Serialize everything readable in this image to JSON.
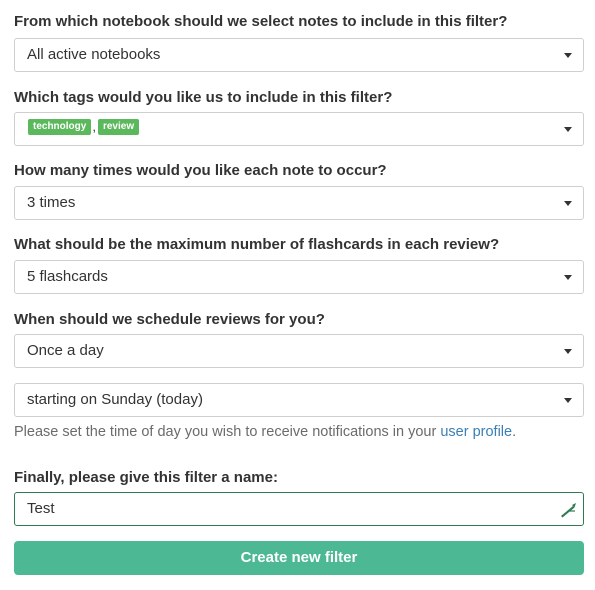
{
  "form": {
    "notebook": {
      "question": "From which notebook should we select notes to include in this filter?",
      "selected": "All active notebooks"
    },
    "tags": {
      "question": "Which tags would you like us to include in this filter?",
      "items": [
        "technology",
        "review"
      ],
      "separator": ","
    },
    "occurrences": {
      "question": "How many times would you like each note to occur?",
      "selected": "3 times"
    },
    "max_flashcards": {
      "question": "What should be the maximum number of flashcards in each review?",
      "selected": "5 flashcards"
    },
    "schedule": {
      "question": "When should we schedule reviews for you?",
      "frequency": "Once a day",
      "start": "starting on Sunday (today)",
      "hint_prefix": "Please set the time of day you wish to receive notifications in your ",
      "hint_link": "user profile",
      "hint_suffix": "."
    },
    "name": {
      "question": "Finally, please give this filter a name:",
      "value": "Test"
    },
    "submit_label": "Create new filter"
  },
  "icons": {
    "dropdown": "caret-down-icon",
    "name_field": "pen-icon"
  },
  "colors": {
    "tag_bg": "#5cb85c",
    "link": "#3a7fb5",
    "submit_bg": "#4cb894",
    "active_border": "#2f7a52"
  }
}
